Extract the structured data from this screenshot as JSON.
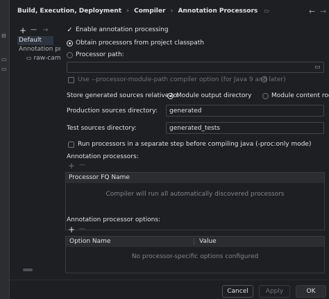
{
  "header": {
    "crumbs": [
      "Build, Execution, Deployment",
      "Compiler",
      "Annotation Processors"
    ],
    "sep": "›",
    "back_icon": "←",
    "forward_icon": "→"
  },
  "left": {
    "toolbar": {
      "add": "+",
      "remove": "—",
      "move": "→"
    },
    "items": [
      "Default",
      "Annotation profi",
      "raw-camer"
    ]
  },
  "form": {
    "enable_label": "Enable annotation processing",
    "obtain_label": "Obtain processors from project classpath",
    "path_label": "Processor path:",
    "module_path_label": "Use --processor-module-path compiler option (for Java 9 and later)",
    "store_label": "Store generated sources relative to:",
    "module_output_label": "Module output directory",
    "module_content_label": "Module content root",
    "production_label": "Production sources directory:",
    "production_value": "generated",
    "test_label": "Test sources directory:",
    "test_value": "generated_tests",
    "separate_step_label": "Run processors in a separate step before compiling java (-proc:only mode)"
  },
  "processors": {
    "section_label": "Annotation processors:",
    "column": "Processor FQ Name",
    "empty_text": "Compiler will run all automatically discovered processors"
  },
  "options": {
    "section_label": "Annotation processor options:",
    "col_name": "Option Name",
    "col_value": "Value",
    "empty_text": "No processor-specific options configured"
  },
  "footer": {
    "cancel": "Cancel",
    "apply": "Apply",
    "ok": "OK"
  },
  "colors": {
    "accent": "#3574f0",
    "panel": "#2b2d30",
    "bg": "#1e1f22"
  }
}
